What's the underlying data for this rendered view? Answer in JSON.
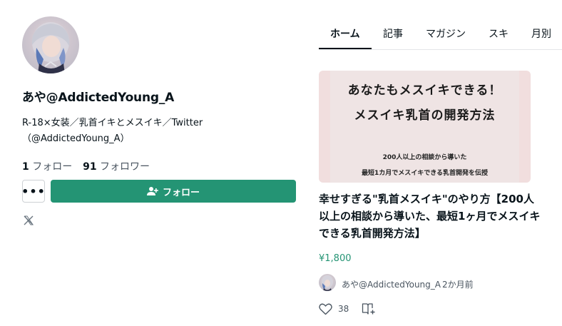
{
  "profile": {
    "name": "あや@AddictedYoung_A",
    "bio": "R-18×女装／乳首イキとメスイキ／Twitter（@AddictedYoung_A）",
    "following_count": "1",
    "following_label": "フォロー",
    "followers_count": "91",
    "followers_label": "フォロワー",
    "more_label": "•••",
    "follow_button_label": "フォロー",
    "social_icon": "x-icon"
  },
  "tabs": [
    {
      "label": "ホーム",
      "active": true
    },
    {
      "label": "記事",
      "active": false
    },
    {
      "label": "マガジン",
      "active": false
    },
    {
      "label": "スキ",
      "active": false
    },
    {
      "label": "月別",
      "active": false
    }
  ],
  "article": {
    "thumbnail": {
      "line1": "あなたもメスイキできる！",
      "line2": "メスイキ乳首の開発方法",
      "line3": "200人以上の相談から導いた",
      "line4": "最短1カ月でメスイキできる乳首開発を伝授"
    },
    "title": "幸せすぎる\"乳首メスイキ\"のやり方【200人以上の相談から導いた、最短1ヶ月でメスイキできる乳首開発方法】",
    "price": "¥1,800",
    "author_name": "あや@AddictedYoung_A",
    "time_ago": "2か月前",
    "like_count": "38"
  },
  "colors": {
    "accent": "#249474",
    "text": "#08131a",
    "muted": "#4a5560",
    "thumbnail_bg": "#f1dede"
  }
}
